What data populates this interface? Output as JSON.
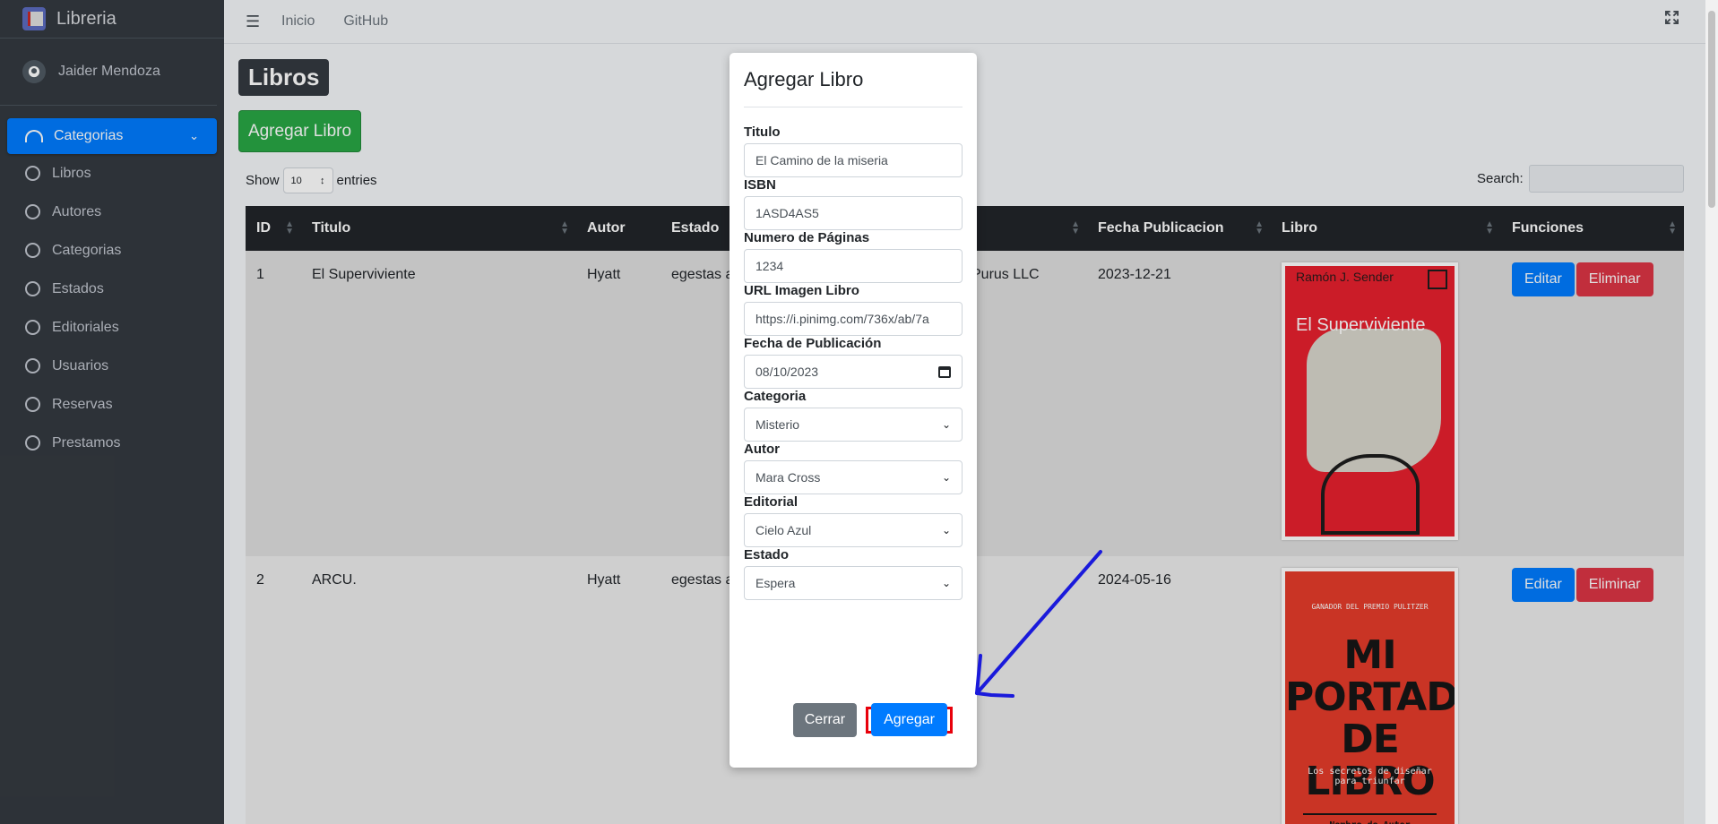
{
  "brand": {
    "name": "Libreria"
  },
  "user": {
    "name": "Jaider Mendoza"
  },
  "sidebar": {
    "active": "Categorias",
    "items": [
      "Libros",
      "Autores",
      "Categorias",
      "Estados",
      "Editoriales",
      "Usuarios",
      "Reservas",
      "Prestamos"
    ]
  },
  "topbar": {
    "links": [
      "Inicio",
      "GitHub"
    ]
  },
  "page": {
    "title": "Libros",
    "add_button": "Agregar Libro"
  },
  "datatable": {
    "show_label": "Show",
    "length_value": "10",
    "entries_label": "entries",
    "search_label": "Search:",
    "columns": [
      "ID",
      "Titulo",
      "Autor",
      "Estado",
      "",
      "Fecha Publicacion",
      "Libro",
      "Funciones"
    ],
    "rows": [
      {
        "id": "1",
        "titulo": "El Superviviente",
        "autor": "Hyatt",
        "estado": "egestas a",
        "editorial": "Purus LLC",
        "fecha": "2023-12-21",
        "cover_author": "Ramón J. Sender",
        "cover_title": "El Superviviente"
      },
      {
        "id": "2",
        "titulo": "ARCU.",
        "autor": "Hyatt",
        "estado": "egestas a",
        "editorial": "",
        "fecha": "2024-05-16",
        "cover_small": "GANADOR DEL PREMIO PULITZER",
        "cover_big_1": "MI",
        "cover_big_2": "PORTADA",
        "cover_big_3": "DE LIBRO",
        "cover_sub": "Los secretos de diseñar para triunfar",
        "cover_author": "Nombre de Autor"
      }
    ],
    "edit_label": "Editar",
    "delete_label": "Eliminar"
  },
  "modal": {
    "title": "Agregar Libro",
    "fields": {
      "titulo": {
        "label": "Titulo",
        "value": "El Camino de la miseria"
      },
      "isbn": {
        "label": "ISBN",
        "value": "1ASD4AS5"
      },
      "paginas": {
        "label": "Numero de Páginas",
        "value": "1234"
      },
      "url": {
        "label": "URL Imagen Libro",
        "value": "https://i.pinimg.com/736x/ab/7a"
      },
      "fecha": {
        "label": "Fecha de Publicación",
        "value": "08/10/2023"
      },
      "categoria": {
        "label": "Categoria",
        "value": "Misterio"
      },
      "autor": {
        "label": "Autor",
        "value": "Mara Cross"
      },
      "editorial": {
        "label": "Editorial",
        "value": "Cielo Azul"
      },
      "estado": {
        "label": "Estado",
        "value": "Espera"
      }
    },
    "close_label": "Cerrar",
    "submit_label": "Agregar"
  },
  "colors": {
    "primary": "#007bff",
    "success": "#28a745",
    "danger": "#dc3545",
    "sidebar": "#343a40",
    "highlight": "#e8000b",
    "annotation_arrow": "#1a1adb"
  }
}
